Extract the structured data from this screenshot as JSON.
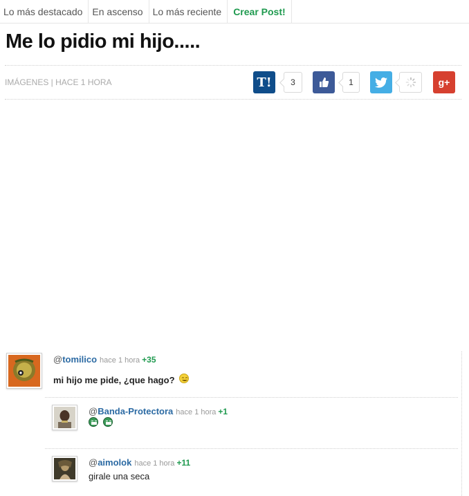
{
  "nav": {
    "items": [
      "Lo más destacado",
      "En ascenso",
      "Lo más reciente"
    ],
    "create_label": "Crear Post!"
  },
  "post": {
    "title": "Me lo pidio mi hijo.....",
    "meta": "IMÁGENES | HACE 1 HORA"
  },
  "share": {
    "taringa_label": "T!",
    "taringa_count": "3",
    "facebook_count": "1",
    "googleplus_label": "g+"
  },
  "comments": [
    {
      "user": "tomilico",
      "time": "hace 1 hora",
      "votes": "+35",
      "text": "mi hijo me pide, ¿que hago?",
      "emoji": "laughing-emoji"
    },
    {
      "user": "Banda-Protectora",
      "time": "hace 1 hora",
      "votes": "+1",
      "text": "",
      "emoji": "laughing-emoji"
    },
    {
      "user": "aimolok",
      "time": "hace 1 hora",
      "votes": "+11",
      "text": "girale una seca"
    }
  ],
  "colors": {
    "create_post": "#1f9a4f",
    "username": "#2b6aa3",
    "votes": "#1f9a4f",
    "taringa": "#0f4d8a",
    "facebook": "#3d5a98",
    "twitter": "#45aee5",
    "googleplus": "#d6402f"
  }
}
